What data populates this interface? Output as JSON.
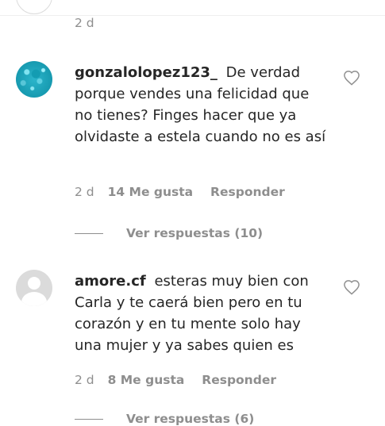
{
  "top_partial": {
    "time": "2 d"
  },
  "comments": [
    {
      "username": "gonzalolopez123_",
      "text": "De verdad porque vendes una felicidad que no tienes? Finges hacer que ya olvidaste a estela cuando no es así",
      "time": "2 d",
      "likes": "14 Me gusta",
      "reply": "Responder",
      "view_replies": "Ver respuestas (10)",
      "avatar": "teal-glitter-avatar"
    },
    {
      "username": "amore.cf",
      "text": "esteras muy bien con Carla y te caerá bien pero en tu corazón y en tu mente solo hay una mujer y ya sabes quien es",
      "time": "2 d",
      "likes": "8 Me gusta",
      "reply": "Responder",
      "view_replies": "Ver respuestas (6)",
      "avatar": "default-avatar"
    }
  ],
  "icons": {
    "like": "heart-outline-icon"
  },
  "colors": {
    "text": "#262626",
    "secondary": "#8e8e8e",
    "divider": "#efefef"
  }
}
